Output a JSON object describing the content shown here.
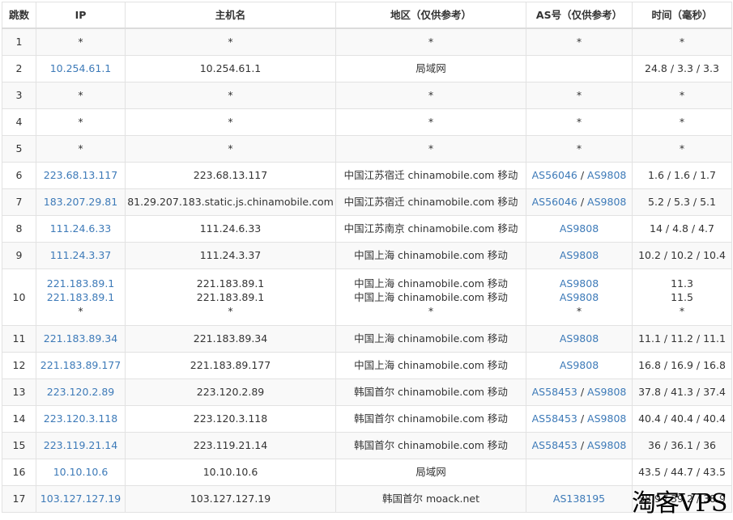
{
  "headers": [
    "跳数",
    "IP",
    "主机名",
    "地区（仅供参考）",
    "AS号（仅供参考）",
    "时间（毫秒）"
  ],
  "rows": [
    {
      "hop": "1",
      "ip": [
        "*"
      ],
      "host": [
        "*"
      ],
      "region": [
        "*"
      ],
      "as": [
        [
          {
            "t": "*"
          }
        ]
      ],
      "time": [
        "*"
      ]
    },
    {
      "hop": "2",
      "ip": [
        "10.254.61.1"
      ],
      "host": [
        "10.254.61.1"
      ],
      "region": [
        "局域网"
      ],
      "as": [
        []
      ],
      "time": [
        "24.8 / 3.3 / 3.3"
      ]
    },
    {
      "hop": "3",
      "ip": [
        "*"
      ],
      "host": [
        "*"
      ],
      "region": [
        "*"
      ],
      "as": [
        [
          {
            "t": "*"
          }
        ]
      ],
      "time": [
        "*"
      ]
    },
    {
      "hop": "4",
      "ip": [
        "*"
      ],
      "host": [
        "*"
      ],
      "region": [
        "*"
      ],
      "as": [
        [
          {
            "t": "*"
          }
        ]
      ],
      "time": [
        "*"
      ]
    },
    {
      "hop": "5",
      "ip": [
        "*"
      ],
      "host": [
        "*"
      ],
      "region": [
        "*"
      ],
      "as": [
        [
          {
            "t": "*"
          }
        ]
      ],
      "time": [
        "*"
      ]
    },
    {
      "hop": "6",
      "ip": [
        "223.68.13.117"
      ],
      "host": [
        "223.68.13.117"
      ],
      "region": [
        "中国江苏宿迁 chinamobile.com 移动"
      ],
      "as": [
        [
          {
            "t": "AS56046",
            "link": true
          },
          {
            "t": " / "
          },
          {
            "t": "AS9808",
            "link": true
          }
        ]
      ],
      "time": [
        "1.6 / 1.6 / 1.7"
      ]
    },
    {
      "hop": "7",
      "ip": [
        "183.207.29.81"
      ],
      "host": [
        "81.29.207.183.static.js.chinamobile.com"
      ],
      "region": [
        "中国江苏宿迁 chinamobile.com 移动"
      ],
      "as": [
        [
          {
            "t": "AS56046",
            "link": true
          },
          {
            "t": " / "
          },
          {
            "t": "AS9808",
            "link": true
          }
        ]
      ],
      "time": [
        "5.2 / 5.3 / 5.1"
      ]
    },
    {
      "hop": "8",
      "ip": [
        "111.24.6.33"
      ],
      "host": [
        "111.24.6.33"
      ],
      "region": [
        "中国江苏南京 chinamobile.com 移动"
      ],
      "as": [
        [
          {
            "t": "AS9808",
            "link": true
          }
        ]
      ],
      "time": [
        "14 / 4.8 / 4.7"
      ]
    },
    {
      "hop": "9",
      "ip": [
        "111.24.3.37"
      ],
      "host": [
        "111.24.3.37"
      ],
      "region": [
        "中国上海 chinamobile.com 移动"
      ],
      "as": [
        [
          {
            "t": "AS9808",
            "link": true
          }
        ]
      ],
      "time": [
        "10.2 / 10.2 / 10.4"
      ]
    },
    {
      "hop": "10",
      "ip": [
        "221.183.89.1",
        "221.183.89.1",
        "*"
      ],
      "host": [
        "221.183.89.1",
        "221.183.89.1",
        "*"
      ],
      "region": [
        "中国上海 chinamobile.com 移动",
        "中国上海 chinamobile.com 移动",
        "*"
      ],
      "as": [
        [
          {
            "t": "AS9808",
            "link": true
          }
        ],
        [
          {
            "t": "AS9808",
            "link": true
          }
        ],
        [
          {
            "t": "*"
          }
        ]
      ],
      "time": [
        "11.3",
        "11.5",
        "*"
      ]
    },
    {
      "hop": "11",
      "ip": [
        "221.183.89.34"
      ],
      "host": [
        "221.183.89.34"
      ],
      "region": [
        "中国上海 chinamobile.com 移动"
      ],
      "as": [
        [
          {
            "t": "AS9808",
            "link": true
          }
        ]
      ],
      "time": [
        "11.1 / 11.2 / 11.1"
      ]
    },
    {
      "hop": "12",
      "ip": [
        "221.183.89.177"
      ],
      "host": [
        "221.183.89.177"
      ],
      "region": [
        "中国上海 chinamobile.com 移动"
      ],
      "as": [
        [
          {
            "t": "AS9808",
            "link": true
          }
        ]
      ],
      "time": [
        "16.8 / 16.9 / 16.8"
      ]
    },
    {
      "hop": "13",
      "ip": [
        "223.120.2.89"
      ],
      "host": [
        "223.120.2.89"
      ],
      "region": [
        "韩国首尔 chinamobile.com 移动"
      ],
      "as": [
        [
          {
            "t": "AS58453",
            "link": true
          },
          {
            "t": " / "
          },
          {
            "t": "AS9808",
            "link": true
          }
        ]
      ],
      "time": [
        "37.8 / 41.3 / 37.4"
      ]
    },
    {
      "hop": "14",
      "ip": [
        "223.120.3.118"
      ],
      "host": [
        "223.120.3.118"
      ],
      "region": [
        "韩国首尔 chinamobile.com 移动"
      ],
      "as": [
        [
          {
            "t": "AS58453",
            "link": true
          },
          {
            "t": " / "
          },
          {
            "t": "AS9808",
            "link": true
          }
        ]
      ],
      "time": [
        "40.4 / 40.4 / 40.4"
      ]
    },
    {
      "hop": "15",
      "ip": [
        "223.119.21.14"
      ],
      "host": [
        "223.119.21.14"
      ],
      "region": [
        "韩国首尔 chinamobile.com 移动"
      ],
      "as": [
        [
          {
            "t": "AS58453",
            "link": true
          },
          {
            "t": " / "
          },
          {
            "t": "AS9808",
            "link": true
          }
        ]
      ],
      "time": [
        "36 / 36.1 / 36"
      ]
    },
    {
      "hop": "16",
      "ip": [
        "10.10.10.6"
      ],
      "host": [
        "10.10.10.6"
      ],
      "region": [
        "局域网"
      ],
      "as": [
        []
      ],
      "time": [
        "43.5 / 44.7 / 43.5"
      ]
    },
    {
      "hop": "17",
      "ip": [
        "103.127.127.19"
      ],
      "host": [
        "103.127.127.19"
      ],
      "region": [
        "韩国首尔 moack.net"
      ],
      "as": [
        [
          {
            "t": "AS138195",
            "link": true
          }
        ]
      ],
      "time": [
        "38.9 / 39.2 / 38.9"
      ]
    }
  ],
  "watermark": "淘客VPS",
  "colors": {
    "link": "#3d7ab8",
    "text": "#333333",
    "border": "#e2e2e2",
    "stripe": "#f9f9f9"
  }
}
